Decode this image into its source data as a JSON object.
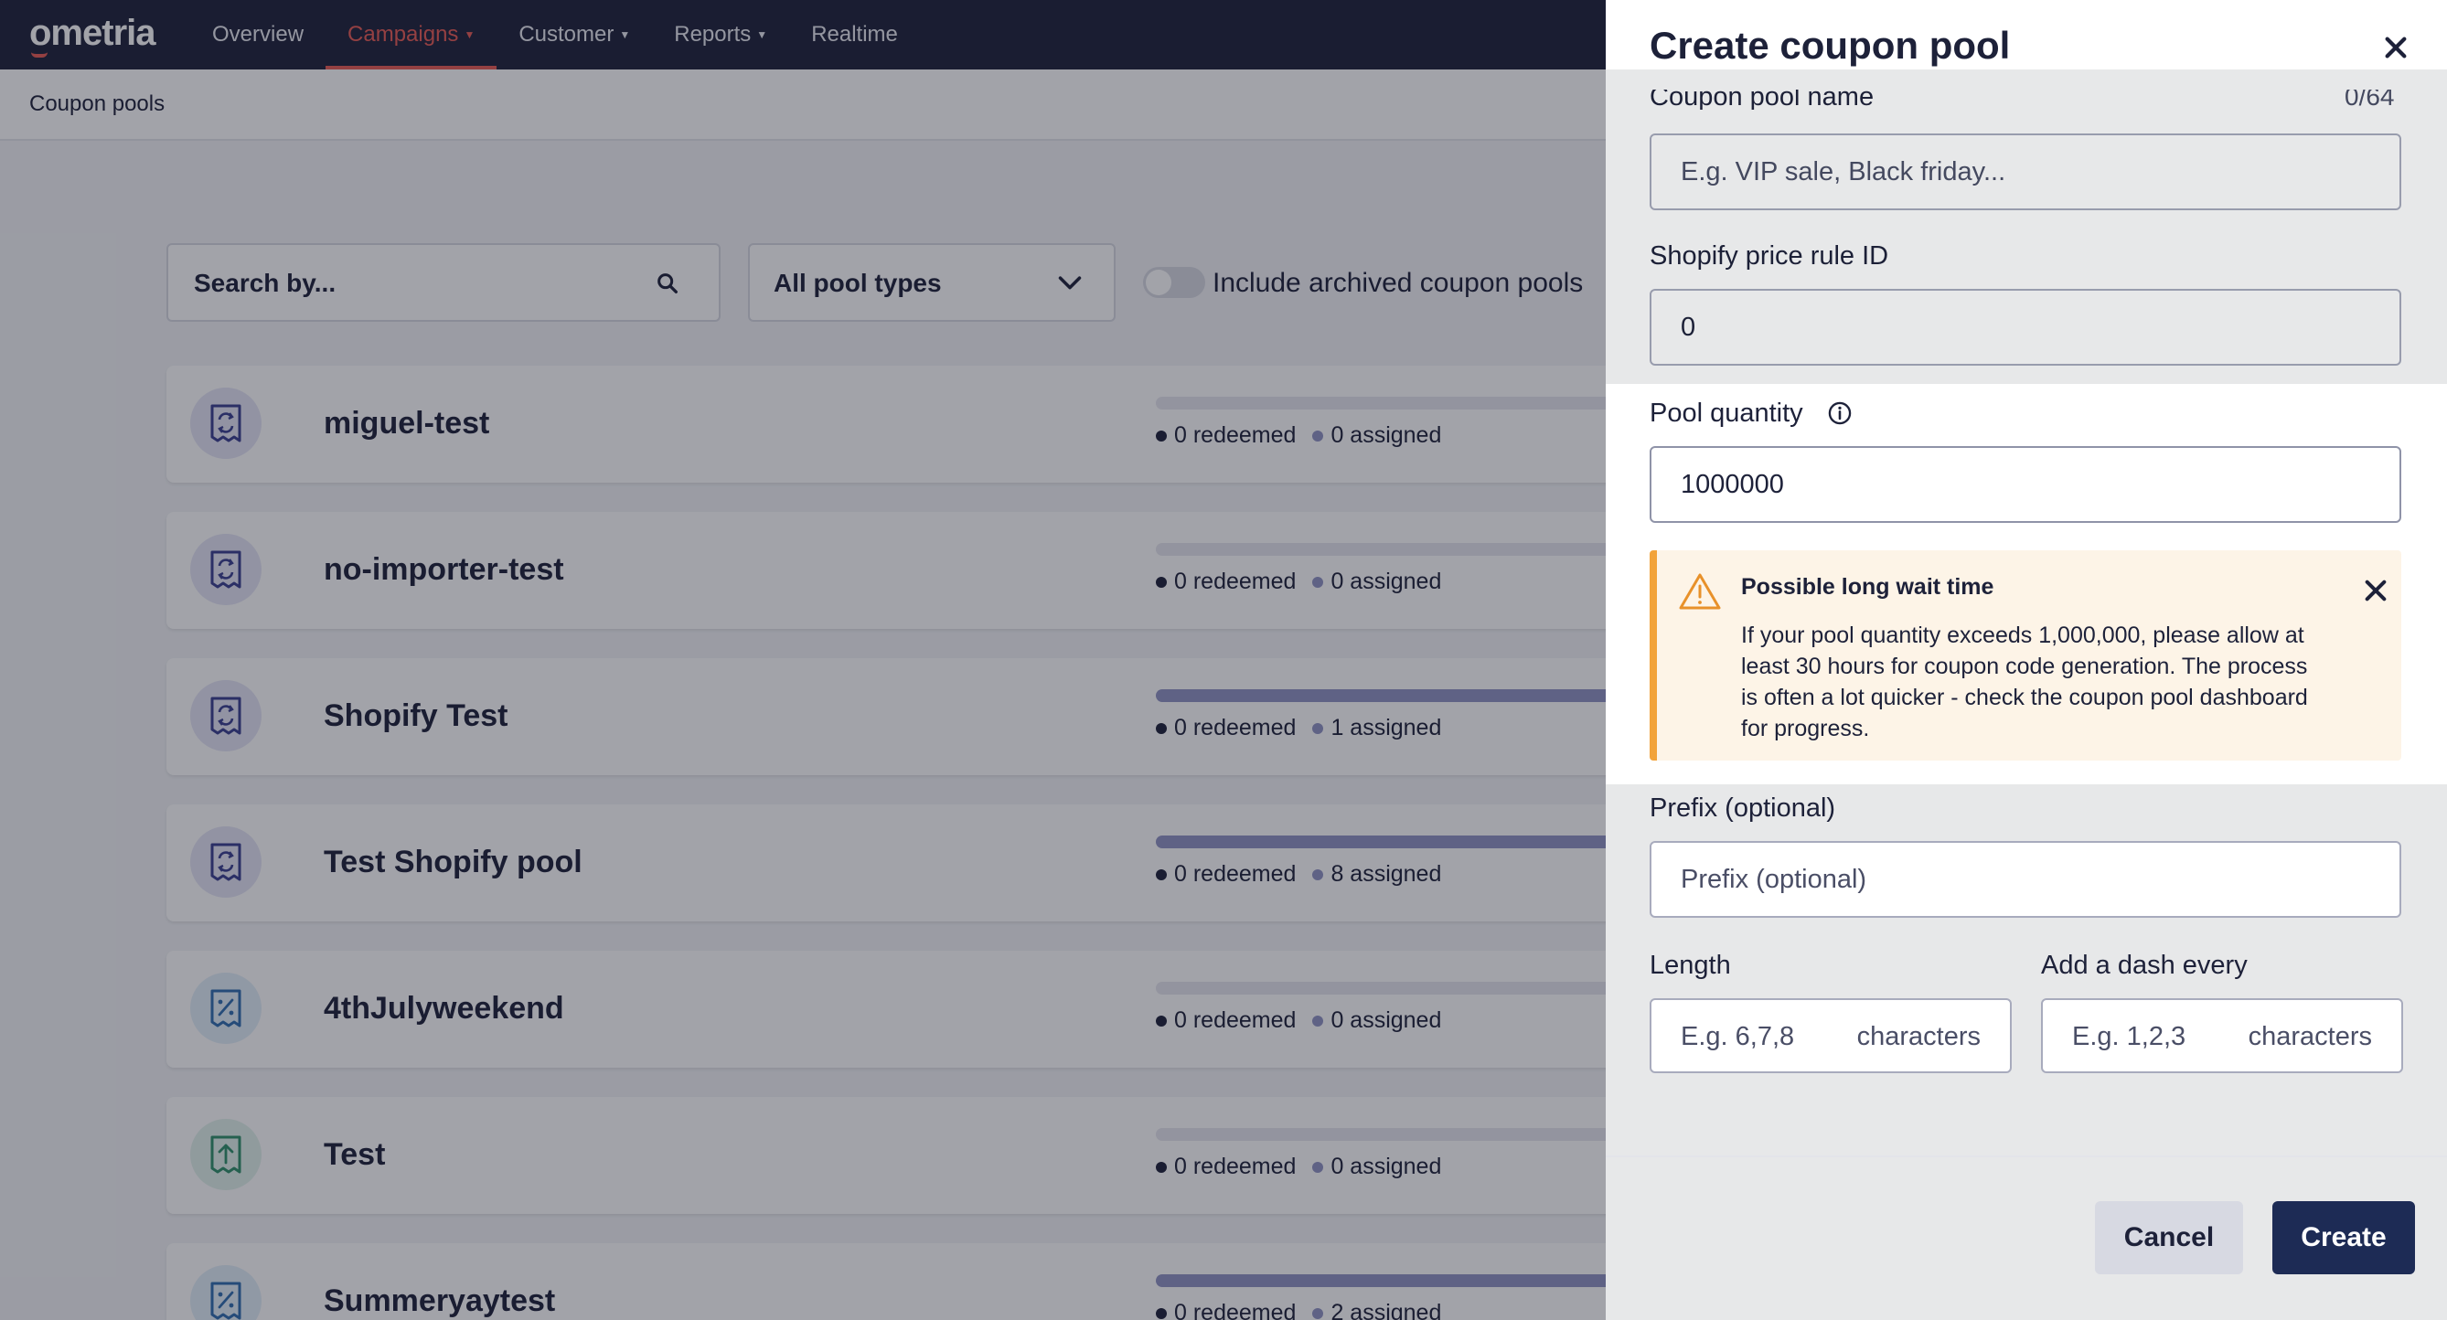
{
  "nav": {
    "logo": "ometria",
    "items": [
      {
        "label": "Overview",
        "caret": false
      },
      {
        "label": "Campaigns",
        "caret": true,
        "active": true
      },
      {
        "label": "Customer",
        "caret": true
      },
      {
        "label": "Reports",
        "caret": true
      },
      {
        "label": "Realtime",
        "caret": false
      }
    ]
  },
  "breadcrumb": "Coupon pools",
  "filters": {
    "search_placeholder": "Search by...",
    "pool_type": "All pool types",
    "include_archived_label": "Include archived coupon pools",
    "include_archived": false
  },
  "pools": [
    {
      "name": "miguel-test",
      "redeemed": "0 redeemed",
      "assigned": "0 assigned",
      "icon": "refresh-receipt-icon",
      "filled": false
    },
    {
      "name": "no-importer-test",
      "redeemed": "0 redeemed",
      "assigned": "0 assigned",
      "icon": "refresh-receipt-icon",
      "filled": false
    },
    {
      "name": "Shopify Test",
      "redeemed": "0 redeemed",
      "assigned": "1 assigned",
      "icon": "refresh-receipt-icon",
      "filled": true
    },
    {
      "name": "Test Shopify pool",
      "redeemed": "0 redeemed",
      "assigned": "8 assigned",
      "icon": "refresh-receipt-icon",
      "filled": true
    },
    {
      "name": "4thJulyweekend",
      "redeemed": "0 redeemed",
      "assigned": "0 assigned",
      "icon": "percent-receipt-icon",
      "filled": false
    },
    {
      "name": "Test",
      "redeemed": "0 redeemed",
      "assigned": "0 assigned",
      "icon": "upload-receipt-icon",
      "filled": false
    },
    {
      "name": "Summeryaytest",
      "redeemed": "0 redeemed",
      "assigned": "2 assigned",
      "icon": "percent-receipt-icon",
      "filled": true
    }
  ],
  "panel": {
    "title": "Create coupon pool",
    "pool_name_label": "Coupon pool name",
    "pool_name_counter": "0/64",
    "pool_name_placeholder": "E.g. VIP sale, Black friday...",
    "price_rule_label": "Shopify price rule ID",
    "price_rule_value": "0",
    "quantity_label": "Pool quantity",
    "quantity_value": "1000000",
    "warning": {
      "title": "Possible long wait time",
      "body": "If your pool quantity exceeds 1,000,000, please allow at least 30 hours for coupon code generation. The process is often a lot quicker - check the coupon pool dashboard for progress."
    },
    "prefix_label": "Prefix (optional)",
    "prefix_placeholder": "Prefix (optional)",
    "length_label": "Length",
    "length_placeholder": "E.g. 6,7,8",
    "length_suffix": "characters",
    "dash_label": "Add a dash every",
    "dash_placeholder": "E.g. 1,2,3",
    "dash_suffix": "characters",
    "cancel_label": "Cancel",
    "create_label": "Create"
  },
  "colors": {
    "nav_bg": "#1d2139",
    "accent": "#e85a54",
    "warning_border": "#f2a33a",
    "primary_button": "#1d2b55"
  }
}
